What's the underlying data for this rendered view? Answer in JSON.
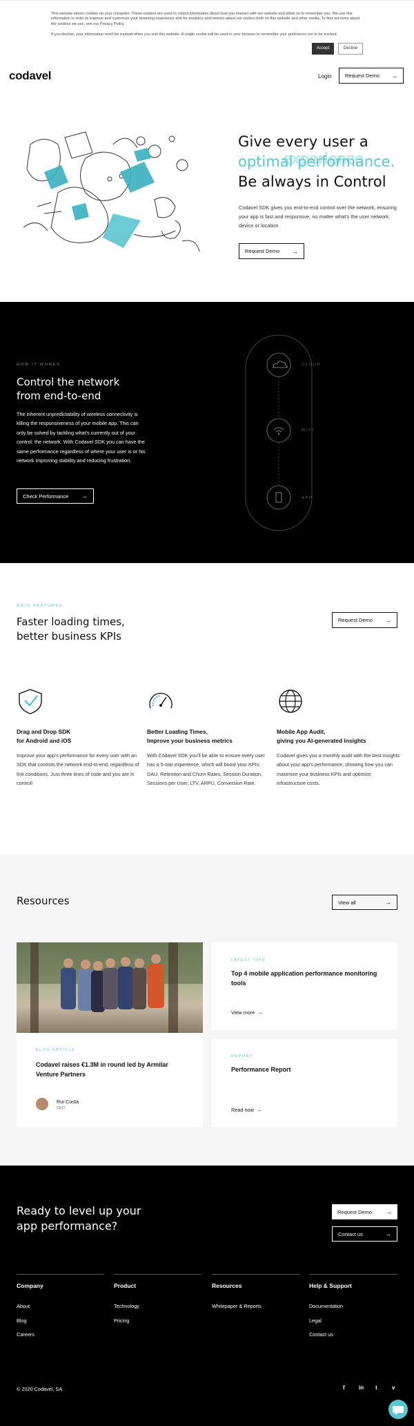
{
  "cookie": {
    "text1": "This website stores cookies on your computer. These cookies are used to collect information about how you interact with our website and allow us to remember you. We use this information in order to improve and customize your browsing experience and for analytics and metrics about our visitors both on this website and other media. To find out more about the cookies we use, see our Privacy Policy.",
    "text2": "If you decline, your information won't be tracked when you visit this website. A single cookie will be used in your browser to remember your preference not to be tracked.",
    "accept_label": "Accept",
    "decline_label": "Decline"
  },
  "header": {
    "logo": "codavel",
    "login_label": "Login",
    "request_demo_label": "Request Demo"
  },
  "hero": {
    "line1": "Give every user a",
    "line2": "optimal performance.",
    "line2_overlay": "experience",
    "line3": "Be always in Control",
    "paragraph": "Codavel SDK gives you end-to-end control over the network, ensuring your app is fast and responsive, no matter what's the user network, device or location",
    "button_label": "Request Demo"
  },
  "how_it_works": {
    "eyebrow": "HOW IT WORKS",
    "title_line1": "Control the network",
    "title_line2": "from end-to-end",
    "paragraph": "The inherent unpredictability of wireless connectivity is killing the responsiveness of your mobile app. This can only be solved by tackling what's currently out of your control: the network. With Codavel SDK you can have the same performance regardless of where your user is or his network improving stability and reducing frustration.",
    "button_label": "Check Performance",
    "diagram_labels": [
      "CLOUD",
      "WIFI",
      "APP"
    ]
  },
  "features": {
    "eyebrow": "MAIN FEATURES",
    "title_line1": "Faster loading times,",
    "title_line2": "better business KPIs",
    "button_label": "Request Demo",
    "items": [
      {
        "icon": "shield-check-icon",
        "title_line1": "Drag and Drop SDK",
        "title_line2": "for Android and iOS",
        "text": "Improve your app's performance for every user with an SDK that controls the network end-to-end, regardless of link conditions. Just three lines of code and you are in control!"
      },
      {
        "icon": "speedometer-icon",
        "title_line1": "Better Loading Times,",
        "title_line2": "Improve your business metrics",
        "text": "With Codavel SDK you'll be able to ensure every user has a 5-star experience, which will boost your KPIs: DAU, Retention and Churn Rates, Session Duration, Sessions per User, LTV, ARPU, Conversion Rate."
      },
      {
        "icon": "globe-icon",
        "title_line1": "Mobile App Audit,",
        "title_line2": "giving you AI-generated insights",
        "text": "Codavel gives you a monthly audit with the best insights about your app's performance, showing how you can maximize your business KPIs and optimize infrastructure costs."
      }
    ]
  },
  "resources": {
    "title": "Resources",
    "view_all_label": "View all",
    "cards": [
      {
        "tag": "BLOG ARTICLE",
        "title": "Codavel raises €1.3M in round led by Armilar Venture Partners",
        "author_name": "Rui Costa",
        "author_role": "CEO"
      },
      {
        "tag": "LATEST TIPS",
        "title": "Top 4 mobile application performance monitoring tools",
        "link": "View more"
      },
      {
        "tag": "REPORT",
        "title": "Performance Report",
        "link": "Read now"
      }
    ]
  },
  "cta": {
    "title_line1": "Ready to level up your",
    "title_line2": "app performance?",
    "request_demo_label": "Request Demo",
    "contact_label": "Contact us"
  },
  "footer": {
    "columns": [
      {
        "title": "Company",
        "links": [
          "About",
          "Blog",
          "Careers"
        ]
      },
      {
        "title": "Product",
        "links": [
          "Technology",
          "Pricing"
        ]
      },
      {
        "title": "Resources",
        "links": [
          "Whitepaper & Reports"
        ]
      },
      {
        "title": "Help & Support",
        "links": [
          "Documentation",
          "Legal",
          "Contact us"
        ]
      }
    ],
    "copyright": "© 2020 Codavel, SA",
    "social": [
      "facebook-icon",
      "linkedin-icon",
      "twitter-icon",
      "vimeo-icon"
    ],
    "social_glyphs": [
      "f",
      "in",
      "t",
      "v"
    ]
  },
  "colors": {
    "accent": "#5ac6cf",
    "dark": "#000000",
    "light_bg": "#f6f6f6"
  }
}
